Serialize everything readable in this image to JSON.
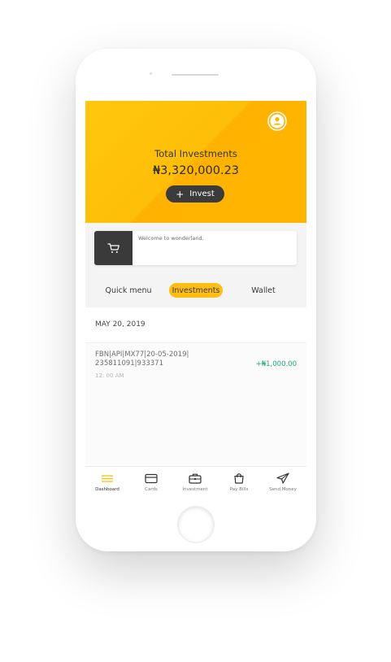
{
  "header": {
    "title": "Total Investments",
    "amount": "₦3,320,000.23",
    "invest_button": "Invest",
    "profile_icon": "user-circle-icon"
  },
  "promo": {
    "icon": "cart-icon",
    "text": "Welcome to wonderland."
  },
  "tabs": [
    {
      "label": "Quick menu",
      "active": false
    },
    {
      "label": "Investments",
      "active": true
    },
    {
      "label": "Wallet",
      "active": false
    }
  ],
  "transactions": {
    "date": "MAY 20, 2019",
    "items": [
      {
        "description_line1": "FBN|API|MX77|20-05-2019|",
        "description_line2": "235811091|933371",
        "time": "12: 00 AM",
        "amount": "+₦1,000.00"
      }
    ]
  },
  "nav": [
    {
      "label": "Dashboard",
      "icon": "menu-icon",
      "active": true
    },
    {
      "label": "Cards",
      "icon": "card-icon",
      "active": false
    },
    {
      "label": "Investment",
      "icon": "briefcase-icon",
      "active": false
    },
    {
      "label": "Pay Bills",
      "icon": "shopping-bag-icon",
      "active": false
    },
    {
      "label": "Send Money",
      "icon": "paper-plane-icon",
      "active": false
    }
  ],
  "colors": {
    "accent": "#ffbe11",
    "positive": "#1fa97c",
    "dark": "#3b3b3b"
  }
}
